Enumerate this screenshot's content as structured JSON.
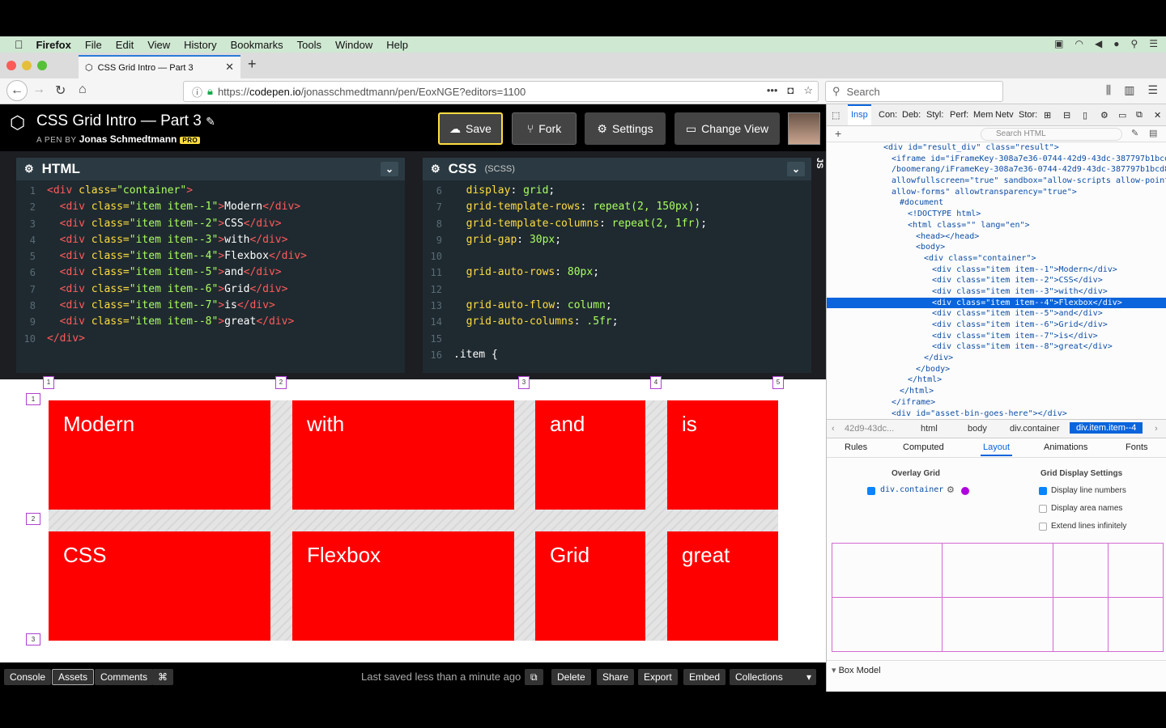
{
  "menubar": {
    "apple": "",
    "app": "Firefox",
    "items": [
      "File",
      "Edit",
      "View",
      "History",
      "Bookmarks",
      "Tools",
      "Window",
      "Help"
    ]
  },
  "tab": {
    "title": "CSS Grid Intro — Part 3",
    "close": "✕",
    "new": "+"
  },
  "url": {
    "prefix": "https://",
    "domain": "codepen.io",
    "path": "/jonasschmedtmann/pen/EoxNGE?editors=1100"
  },
  "search": {
    "placeholder": "Search"
  },
  "codepen": {
    "title": "CSS Grid Intro — Part 3",
    "by_label": "A PEN BY",
    "author": "Jonas Schmedtmann",
    "pro": "PRO",
    "buttons": {
      "save": "Save",
      "fork": "Fork",
      "settings": "Settings",
      "change_view": "Change View"
    }
  },
  "html_editor": {
    "title": "HTML",
    "lines": [
      {
        "n": "1",
        "open": "<div ",
        "attr": "class=",
        "val": "\"container\"",
        "close": ">",
        "text": "",
        "end": ""
      },
      {
        "n": "2",
        "open": "  <div ",
        "attr": "class=",
        "val": "\"item item--1\"",
        "close": ">",
        "text": "Modern",
        "end": "</div>"
      },
      {
        "n": "3",
        "open": "  <div ",
        "attr": "class=",
        "val": "\"item item--2\"",
        "close": ">",
        "text": "CSS",
        "end": "</div>"
      },
      {
        "n": "4",
        "open": "  <div ",
        "attr": "class=",
        "val": "\"item item--3\"",
        "close": ">",
        "text": "with",
        "end": "</div>"
      },
      {
        "n": "5",
        "open": "  <div ",
        "attr": "class=",
        "val": "\"item item--4\"",
        "close": ">",
        "text": "Flexbox",
        "end": "</div>"
      },
      {
        "n": "6",
        "open": "  <div ",
        "attr": "class=",
        "val": "\"item item--5\"",
        "close": ">",
        "text": "and",
        "end": "</div>"
      },
      {
        "n": "7",
        "open": "  <div ",
        "attr": "class=",
        "val": "\"item item--6\"",
        "close": ">",
        "text": "Grid",
        "end": "</div>"
      },
      {
        "n": "8",
        "open": "  <div ",
        "attr": "class=",
        "val": "\"item item--7\"",
        "close": ">",
        "text": "is",
        "end": "</div>"
      },
      {
        "n": "9",
        "open": "  <div ",
        "attr": "class=",
        "val": "\"item item--8\"",
        "close": ">",
        "text": "great",
        "end": "</div>"
      },
      {
        "n": "10",
        "open": "</div>",
        "attr": "",
        "val": "",
        "close": "",
        "text": "",
        "end": ""
      }
    ]
  },
  "css_editor": {
    "title": "CSS",
    "sub": "(SCSS)",
    "lines": [
      {
        "n": "6",
        "prop": "  display",
        "val": "grid"
      },
      {
        "n": "7",
        "prop": "  grid-template-rows",
        "val": "repeat(2, 150px)"
      },
      {
        "n": "8",
        "prop": "  grid-template-columns",
        "val": "repeat(2, 1fr)"
      },
      {
        "n": "9",
        "prop": "  grid-gap",
        "val": "30px"
      },
      {
        "n": "10",
        "prop": "",
        "val": ""
      },
      {
        "n": "11",
        "prop": "  grid-auto-rows",
        "val": "80px"
      },
      {
        "n": "12",
        "prop": "",
        "val": ""
      },
      {
        "n": "13",
        "prop": "  grid-auto-flow",
        "val": "column"
      },
      {
        "n": "14",
        "prop": "  grid-auto-columns",
        "val": ".5fr"
      },
      {
        "n": "15",
        "prop": "",
        "val": ""
      },
      {
        "n": "16",
        "prop": ".item {",
        "val": ""
      }
    ],
    "side_label": "JS"
  },
  "preview": {
    "cells": [
      "Modern",
      "with",
      "and",
      "is",
      "CSS",
      "Flexbox",
      "Grid",
      "great"
    ],
    "col_numbers": [
      "1",
      "2",
      "3",
      "4",
      "5"
    ],
    "row_numbers": [
      "1",
      "2",
      "3"
    ],
    "cell_color": "#ff0000"
  },
  "footer": {
    "buttons": [
      "Console",
      "Assets",
      "Comments",
      "⌘"
    ],
    "saved": "Last saved less than a minute ago",
    "actions": [
      "Delete",
      "Share",
      "Export",
      "Embed",
      "Collections"
    ]
  },
  "devtools": {
    "tabs": [
      "Insp",
      "Con:",
      "Deb:",
      "Styl:",
      "Perf:",
      "Mem",
      "Netv",
      "Stor:"
    ],
    "search_html": "Search HTML",
    "markup": [
      {
        "indent": 7,
        "t": "<div id=\"result_div\" class=\"result\">",
        "sel": false
      },
      {
        "indent": 8,
        "t": "<iframe id=\"iFrameKey-308a7e36-0744-42d9-43dc-387797b1bcd",
        "sel": false
      },
      {
        "indent": 8,
        "t": "/boomerang/iFrameKey-308a7e36-0744-42d9-43dc-387797b1bcd8",
        "sel": false
      },
      {
        "indent": 8,
        "t": "allowfullscreen=\"true\" sandbox=\"allow-scripts allow-point",
        "sel": false
      },
      {
        "indent": 8,
        "t": "allow-forms\" allowtransparency=\"true\">",
        "sel": false
      },
      {
        "indent": 9,
        "t": "#document",
        "sel": false
      },
      {
        "indent": 10,
        "t": "<!DOCTYPE html>",
        "sel": false
      },
      {
        "indent": 10,
        "t": "<html class=\"\" lang=\"en\">",
        "sel": false
      },
      {
        "indent": 11,
        "t": "<head></head>",
        "sel": false
      },
      {
        "indent": 11,
        "t": "<body>",
        "sel": false
      },
      {
        "indent": 12,
        "t": "<div class=\"container\">",
        "sel": false
      },
      {
        "indent": 13,
        "t": "<div class=\"item item--1\">Modern</div>",
        "sel": false
      },
      {
        "indent": 13,
        "t": "<div class=\"item item--2\">CSS</div>",
        "sel": false
      },
      {
        "indent": 13,
        "t": "<div class=\"item item--3\">with</div>",
        "sel": false
      },
      {
        "indent": 13,
        "t": "<div class=\"item item--4\">Flexbox</div>",
        "sel": true
      },
      {
        "indent": 13,
        "t": "<div class=\"item item--5\">and</div>",
        "sel": false
      },
      {
        "indent": 13,
        "t": "<div class=\"item item--6\">Grid</div>",
        "sel": false
      },
      {
        "indent": 13,
        "t": "<div class=\"item item--7\">is</div>",
        "sel": false
      },
      {
        "indent": 13,
        "t": "<div class=\"item item--8\">great</div>",
        "sel": false
      },
      {
        "indent": 12,
        "t": "</div>",
        "sel": false
      },
      {
        "indent": 11,
        "t": "</body>",
        "sel": false
      },
      {
        "indent": 10,
        "t": "</html>",
        "sel": false
      },
      {
        "indent": 9,
        "t": "</html>",
        "sel": false
      },
      {
        "indent": 8,
        "t": "</iframe>",
        "sel": false
      },
      {
        "indent": 8,
        "t": "<div id=\"asset-bin-goes-here\"></div>",
        "sel": false
      }
    ],
    "breadcrumbs": [
      "42d9-43dc...",
      "html",
      "body",
      "div.container",
      "div.item.item--4"
    ],
    "side_tabs": [
      "Rules",
      "Computed",
      "Layout",
      "Animations",
      "Fonts"
    ],
    "layout": {
      "overlay_title": "Overlay Grid",
      "overlay_item": "div.container",
      "settings_title": "Grid Display Settings",
      "opt_line_numbers": "Display line numbers",
      "opt_area_names": "Display area names",
      "opt_extend": "Extend lines infinitely"
    },
    "box_model": "Box Model"
  }
}
